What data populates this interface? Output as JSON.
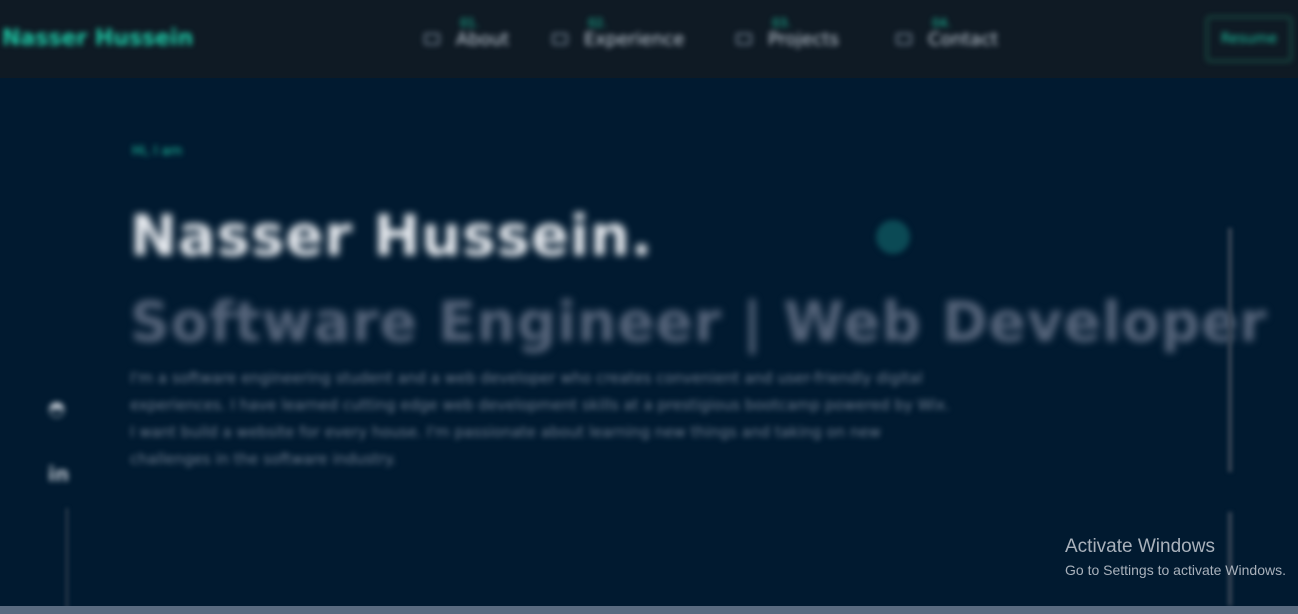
{
  "nav": {
    "brand": "Nasser Hussein",
    "links": [
      {
        "num": "01.",
        "label": "About"
      },
      {
        "num": "02.",
        "label": "Experience"
      },
      {
        "num": "03.",
        "label": "Projects"
      },
      {
        "num": "04.",
        "label": "Contact"
      }
    ],
    "resume_label": "Resume"
  },
  "hero": {
    "greeting": "Hi, I am",
    "name": "Nasser Hussein.",
    "role": "Software Engineer | Web Developer",
    "bio": "I'm a software engineering student and a web developer who creates convenient and user-friendly digital experiences. I have learned cutting edge web development skills at a prestigious bootcamp powered by Wix. I want build a website for every house. I'm passionate about learning new things and taking on new challenges in the software industry."
  },
  "social": {
    "icons": [
      "github-icon",
      "linkedin-icon"
    ],
    "github_glyph": "◓",
    "linkedin_glyph": "in"
  },
  "os_overlay": {
    "title": "Activate Windows",
    "subtitle": "Go to Settings to activate Windows."
  },
  "colors": {
    "background": "#011a30",
    "accent": "#1ec9a6",
    "nav_bg": "#0f1a24"
  }
}
